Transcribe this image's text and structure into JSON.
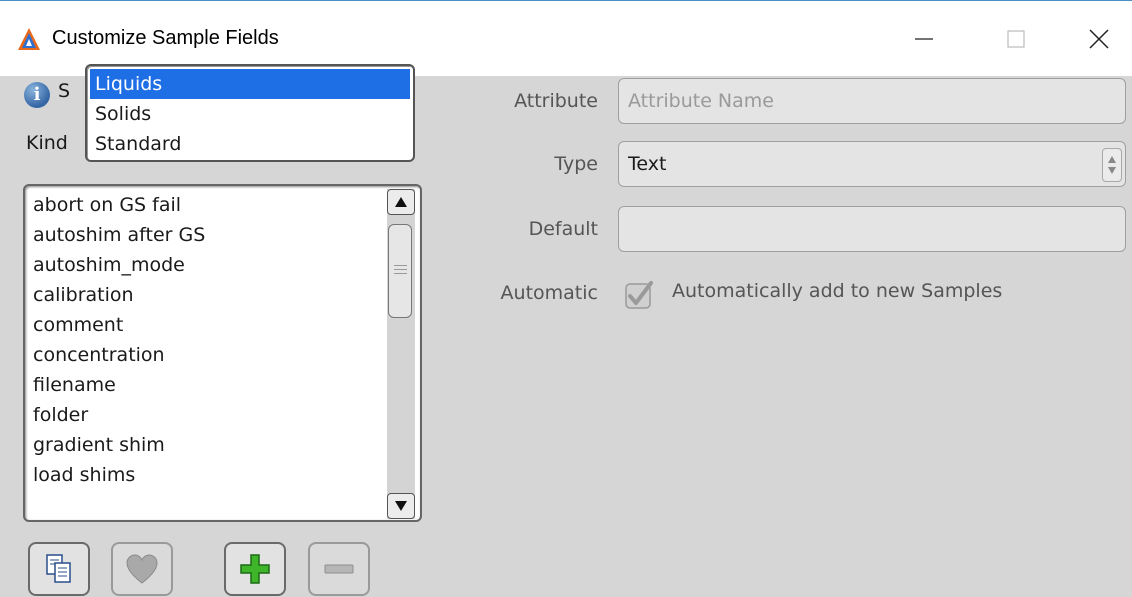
{
  "window": {
    "title": "Customize Sample Fields"
  },
  "left": {
    "label_s": "S",
    "label_kind": "Kind",
    "kind_options": [
      "Liquids",
      "Solids",
      "Standard"
    ],
    "kind_selected": "Liquids",
    "fields": [
      "abort on GS fail",
      "autoshim after GS",
      "autoshim_mode",
      "calibration",
      "comment",
      "concentration",
      "filename",
      "folder",
      "gradient shim",
      "load shims"
    ]
  },
  "form": {
    "attribute_label": "Attribute",
    "attribute_placeholder": "Attribute Name",
    "type_label": "Type",
    "type_value": "Text",
    "default_label": "Default",
    "default_value": "",
    "automatic_label": "Automatic",
    "automatic_checkbox_label": "Automatically add to new Samples",
    "automatic_checked": true
  },
  "colors": {
    "selection": "#1e6ee6",
    "window_bg": "#d6d6d6"
  }
}
